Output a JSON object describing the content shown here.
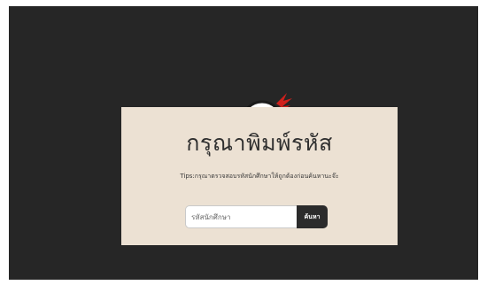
{
  "theme": {
    "page_background": "#262626",
    "card_background": "#ece1d3",
    "button_background": "#2b2b2b",
    "accent_red": "#d0201c"
  },
  "mascot": {
    "icon": "ninja-head-icon"
  },
  "dialog": {
    "title": "กรุณาพิมพ์รหัส",
    "tips": "Tips:กรุณาตรวจสอบรหัสนักศึกษาให้ถูกต้องก่อนค้นหานะจ๊ะ"
  },
  "search": {
    "placeholder": "รหัสนักศึกษา",
    "value": "",
    "button_label": "ค้นหา"
  }
}
